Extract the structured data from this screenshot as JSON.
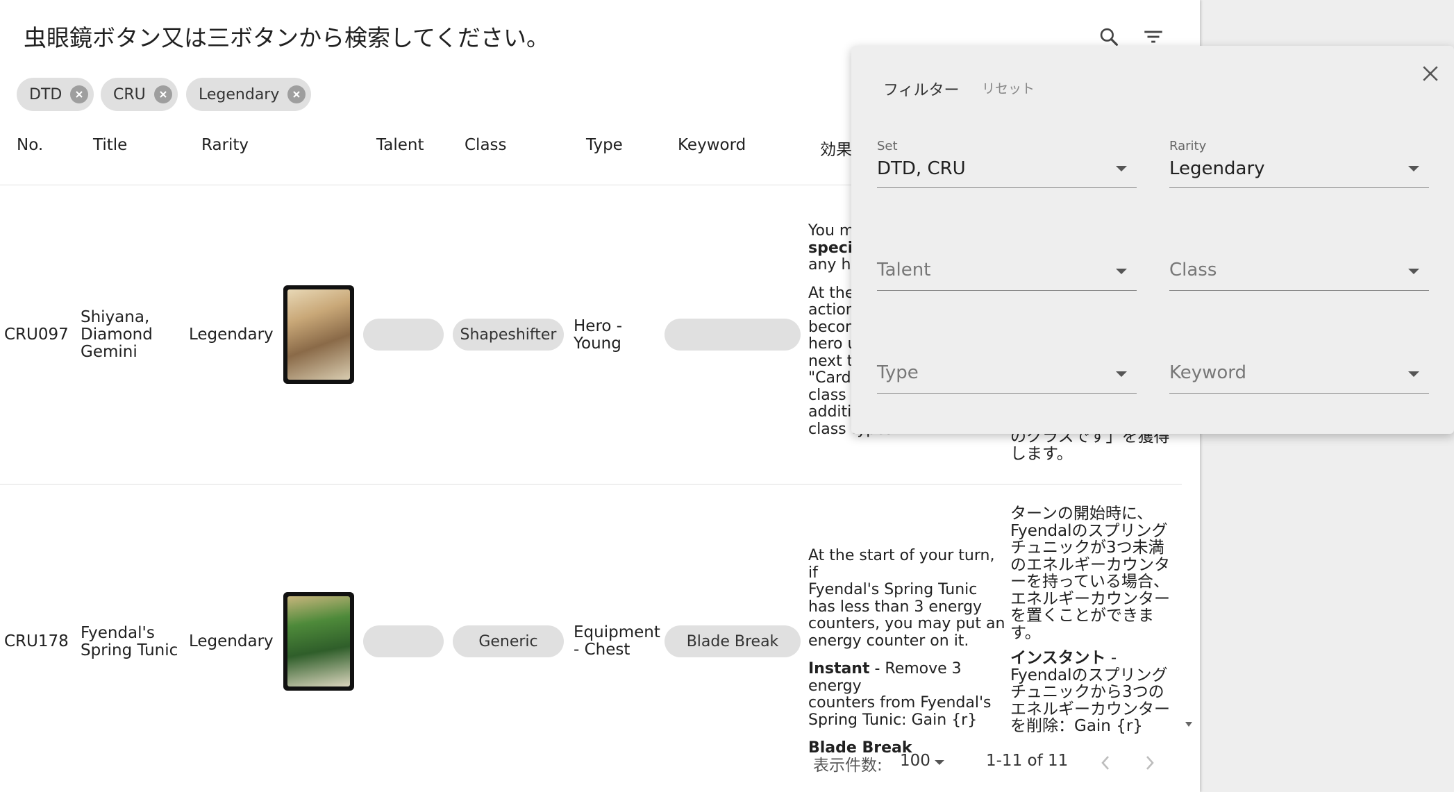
{
  "search": {
    "placeholder": "虫眼鏡ボタン又は三ボタンから検索してください。"
  },
  "chips": [
    {
      "label": "DTD"
    },
    {
      "label": "CRU"
    },
    {
      "label": "Legendary"
    }
  ],
  "table": {
    "headers": [
      "No.",
      "Title",
      "Rarity",
      "Talent",
      "Class",
      "Type",
      "Keyword",
      "効果"
    ],
    "rows": [
      {
        "no": "CRU097",
        "title": [
          "Shiyana,",
          "Diamond",
          "Gemini"
        ],
        "rarity": "Legendary",
        "card_image_title": "Shiyana, Diamond Gemini",
        "talent": "",
        "class": "Shapeshifter",
        "type": [
          "Hero -",
          "Young"
        ],
        "keyword": "",
        "effect_en_para1": [
          "You m",
          "specia",
          "any he"
        ],
        "effect_en_para2": [
          "At the",
          "action",
          "becom",
          "hero u",
          "next t",
          "\"Cards",
          "class",
          "additio",
          "class types.\""
        ],
        "effect_jp": [
          "のクラスです」を獲得",
          "します。"
        ]
      },
      {
        "no": "CRU178",
        "title": [
          "Fyendal's",
          "Spring Tunic"
        ],
        "rarity": "Legendary",
        "card_image_title": "Fyendal's Spring Tunic",
        "talent": "",
        "class": "Generic",
        "type": [
          "Equipment",
          "- Chest"
        ],
        "keyword": "Blade Break",
        "effect_en_para1": [
          "At the start of your turn, if",
          "Fyendal's Spring Tunic",
          "has less than 3 energy",
          "counters, you may put an",
          "energy counter on it."
        ],
        "effect_en_instant_bold": "Instant",
        "effect_en_instant_rest": " - Remove 3 energy",
        "effect_en_para2": [
          "counters from Fyendal's",
          "Spring Tunic: Gain {r}"
        ],
        "effect_en_keyword": "Blade Break",
        "effect_jp_para1": [
          "ターンの開始時に、",
          "Fyendalのスプリング",
          "チュニックが3つ未満",
          "のエネルギーカウンタ",
          "ーを持っている場合、",
          "エネルギーカウンター",
          "を置くことができま",
          "す。"
        ],
        "effect_jp_instant_bold": "インスタント",
        "effect_jp_instant_rest": " -",
        "effect_jp_para2": [
          "Fyendalのスプリング",
          "チュニックから3つの",
          "エネルギーカウンター",
          "を削除：Gain {r}"
        ]
      }
    ]
  },
  "pagination": {
    "rows_label": "表示件数:",
    "rows_per_page": "100",
    "range": "1-11 of 11"
  },
  "filter_panel": {
    "title": "フィルター",
    "reset": "リセット",
    "fields": {
      "set": {
        "label": "Set",
        "value": "DTD, CRU"
      },
      "rarity": {
        "label": "Rarity",
        "value": "Legendary"
      },
      "talent": {
        "placeholder": "Talent"
      },
      "class": {
        "placeholder": "Class"
      },
      "type": {
        "placeholder": "Type"
      },
      "keyword": {
        "placeholder": "Keyword"
      }
    }
  },
  "icons": [
    "search-icon",
    "filter-list-icon",
    "close-icon",
    "chip-remove-icon",
    "chevron-left-icon",
    "chevron-right-icon",
    "dropdown-arrow-icon"
  ],
  "colors": {
    "chip_bg": "#e0e0e0",
    "panel_bg": "#eeeeee",
    "page_bg": "#ffffff",
    "side_bg": "#eeeeee",
    "text": "#212121"
  }
}
